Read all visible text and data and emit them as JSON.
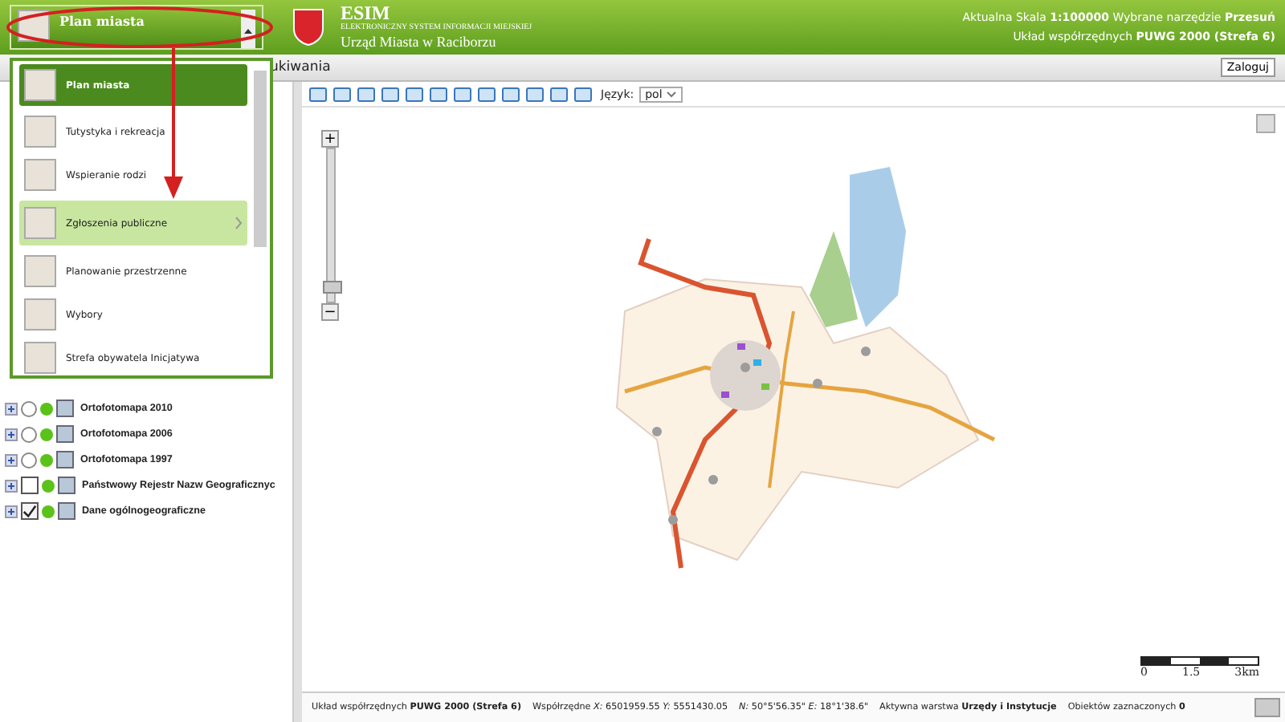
{
  "header": {
    "selector_label": "Plan miasta",
    "logo_title": "ESIM",
    "logo_subtitle": "ELEKTRONICZNY SYSTEM INFORMACJI MIEJSKIEJ",
    "office": "Urząd Miasta w Raciborzu",
    "info_lines": [
      "Aktualna Skala **1:100000**  Wybrane narzędzie **Przesuń**",
      "Układ współrzędnych **PUWG 2000 (Strefa 6)**"
    ]
  },
  "top_bar": {
    "tab_label": "ukiwania",
    "login_button": "Zaloguj"
  },
  "toolbar": {
    "language_label": "Język:",
    "language_value": "pol"
  },
  "dropdown": {
    "items": [
      {
        "label": "Plan miasta",
        "selected": true,
        "hovered": false,
        "has_submenu": false
      },
      {
        "label": "Tutystyka i rekreacja",
        "selected": false,
        "hovered": false,
        "has_submenu": false
      },
      {
        "label": "Wspieranie rodzi",
        "selected": false,
        "hovered": false,
        "has_submenu": false
      },
      {
        "label": "Zgłoszenia publiczne",
        "selected": false,
        "hovered": true,
        "has_submenu": true
      },
      {
        "label": "Planowanie przestrzenne",
        "selected": false,
        "hovered": false,
        "has_submenu": false
      },
      {
        "label": "Wybory",
        "selected": false,
        "hovered": false,
        "has_submenu": false
      },
      {
        "label": "Strefa obywatela Inicjatywa",
        "selected": false,
        "hovered": false,
        "has_submenu": false
      }
    ]
  },
  "layers": [
    {
      "label": "Ortofotomapa 2010",
      "kind": "radio",
      "checked": false
    },
    {
      "label": "Ortofotomapa 2006",
      "kind": "radio",
      "checked": false
    },
    {
      "label": "Ortofotomapa 1997",
      "kind": "radio",
      "checked": false
    },
    {
      "label": "Państwowy Rejestr Nazw Geograficznyc",
      "kind": "checkbox",
      "checked": false
    },
    {
      "label": "Dane ogólnogeograficzne",
      "kind": "checkbox",
      "checked": true
    }
  ],
  "map": {
    "zoom": {
      "plus": "+",
      "minus": "−",
      "level": 0.05
    },
    "scale_labels": [
      "0",
      "1.5",
      "3km"
    ]
  },
  "status_bar": [
    "Układ współrzędnych **PUWG 2000 (Strefa 6)**",
    "Współrzędne *X:* 6501959.55 *Y:* 5551430.05",
    "*N:* 50°5'56.35\" *E:* 18°1'38.6\"",
    "Aktywna warstwa **Urzędy i Instytucje**",
    "Obiektów zaznaczonych **0**"
  ]
}
